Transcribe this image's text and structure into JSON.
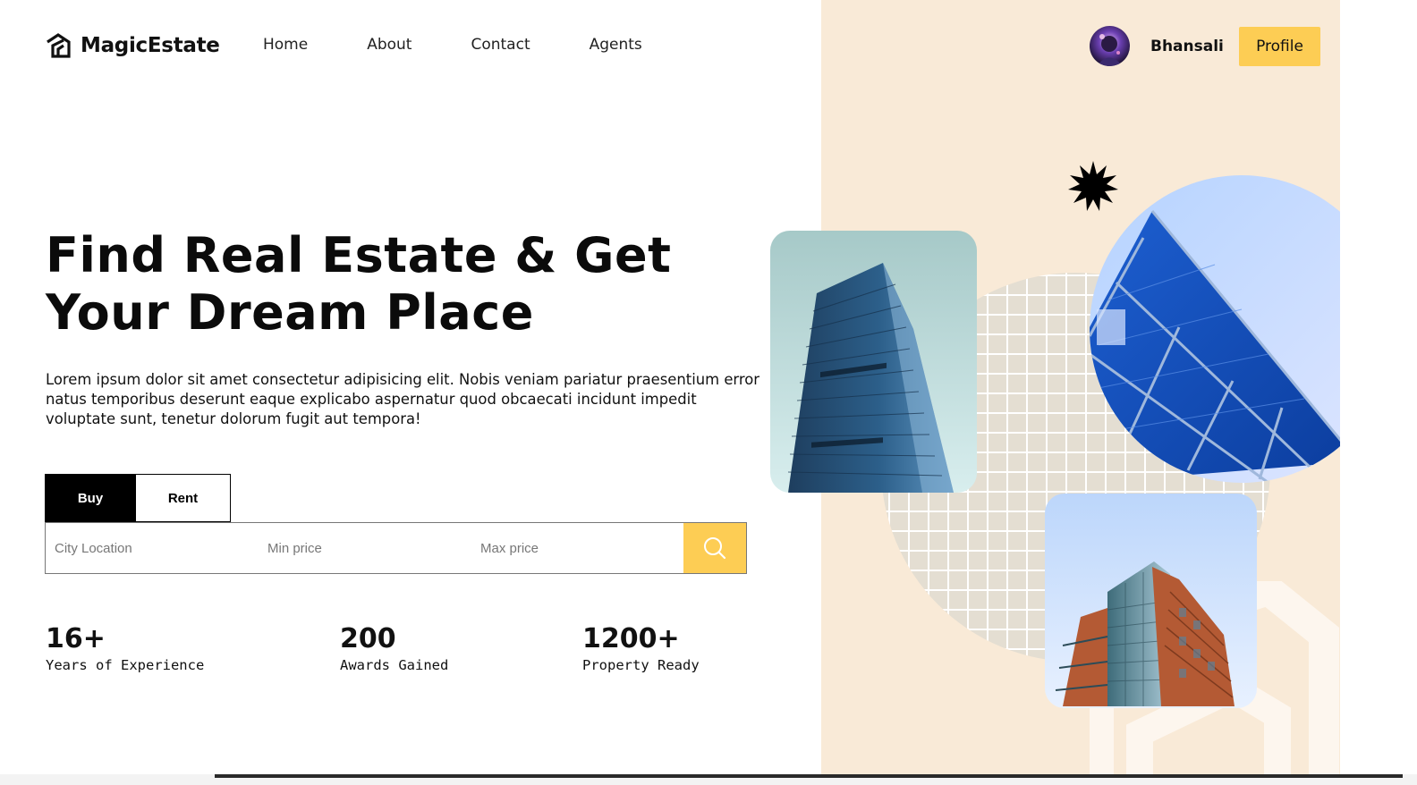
{
  "brand": {
    "name": "MagicEstate",
    "icon": "house-logo-icon"
  },
  "nav": {
    "items": [
      {
        "label": "Home"
      },
      {
        "label": "About"
      },
      {
        "label": "Contact"
      },
      {
        "label": "Agents"
      }
    ]
  },
  "user": {
    "name": "Bhansali",
    "profile_label": "Profile"
  },
  "hero": {
    "title": "Find Real Estate & Get Your Dream Place",
    "description": "Lorem ipsum dolor sit amet consectetur adipisicing elit. Nobis veniam pariatur praesentium error natus temporibus deserunt eaque explicabo aspernatur quod obcaecati incidunt impedit voluptate sunt, tenetur dolorum fugit aut tempora!"
  },
  "search": {
    "tabs": [
      {
        "label": "Buy",
        "active": true
      },
      {
        "label": "Rent",
        "active": false
      }
    ],
    "city_placeholder": "City Location",
    "min_placeholder": "Min price",
    "max_placeholder": "Max price",
    "button_icon": "search-icon"
  },
  "stats": [
    {
      "value": "16+",
      "label": "Years of Experience"
    },
    {
      "value": "200",
      "label": "Awards Gained"
    },
    {
      "value": "1200+",
      "label": "Property Ready"
    }
  ],
  "colors": {
    "accent": "#fdcd54",
    "panel": "#f9ead7",
    "dark": "#000000"
  }
}
